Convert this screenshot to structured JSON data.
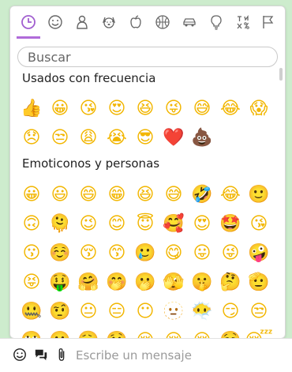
{
  "tabs": [
    {
      "name": "recent",
      "icon": "clock-icon"
    },
    {
      "name": "smileys",
      "icon": "smiley-icon"
    },
    {
      "name": "people",
      "icon": "person-icon"
    },
    {
      "name": "animals",
      "icon": "dog-icon"
    },
    {
      "name": "food",
      "icon": "apple-icon"
    },
    {
      "name": "activities",
      "icon": "basketball-icon"
    },
    {
      "name": "travel",
      "icon": "car-icon"
    },
    {
      "name": "objects",
      "icon": "lightbulb-icon"
    },
    {
      "name": "symbols",
      "icon": "symbols-icon"
    },
    {
      "name": "flags",
      "icon": "flag-icon"
    }
  ],
  "search": {
    "placeholder": "Buscar"
  },
  "sections": {
    "frequent": {
      "title": "Usados con frecuencia",
      "rows": [
        [
          "👍",
          "😀",
          "😘",
          "😍",
          "😆",
          "😜",
          "😅",
          "😂",
          "😱"
        ],
        [
          "😞",
          "😒",
          "😩",
          "😭",
          "😎",
          "❤️",
          "💩"
        ]
      ]
    },
    "smileys": {
      "title": "Emoticonos y personas",
      "rows": [
        [
          "😀",
          "😃",
          "😄",
          "😁",
          "😆",
          "😅",
          "🤣",
          "😂",
          "🙂"
        ],
        [
          "🙃",
          "🫠",
          "😉",
          "😊",
          "😇",
          "🥰",
          "😍",
          "🤩",
          "😘"
        ],
        [
          "😗",
          "☺️",
          "😚",
          "😙",
          "🥲",
          "😋",
          "😛",
          "😜",
          "🤪"
        ],
        [
          "😝",
          "🤑",
          "🤗",
          "🤭",
          "🫢",
          "🫣",
          "🤫",
          "🤔",
          "🫡"
        ],
        [
          "🤐",
          "🤨",
          "😐",
          "😑",
          "😶",
          "🫥",
          "😶‍🌫️",
          "😏",
          "😒"
        ],
        [
          "🙄",
          "😬",
          "😮‍💨",
          "🤥",
          "😌",
          "😔",
          "😪",
          "🤤",
          "😴"
        ]
      ]
    }
  },
  "composer": {
    "placeholder": "Escribe un mensaje"
  },
  "colors": {
    "accent": "#b06bd9",
    "background": "#cdeccd"
  }
}
